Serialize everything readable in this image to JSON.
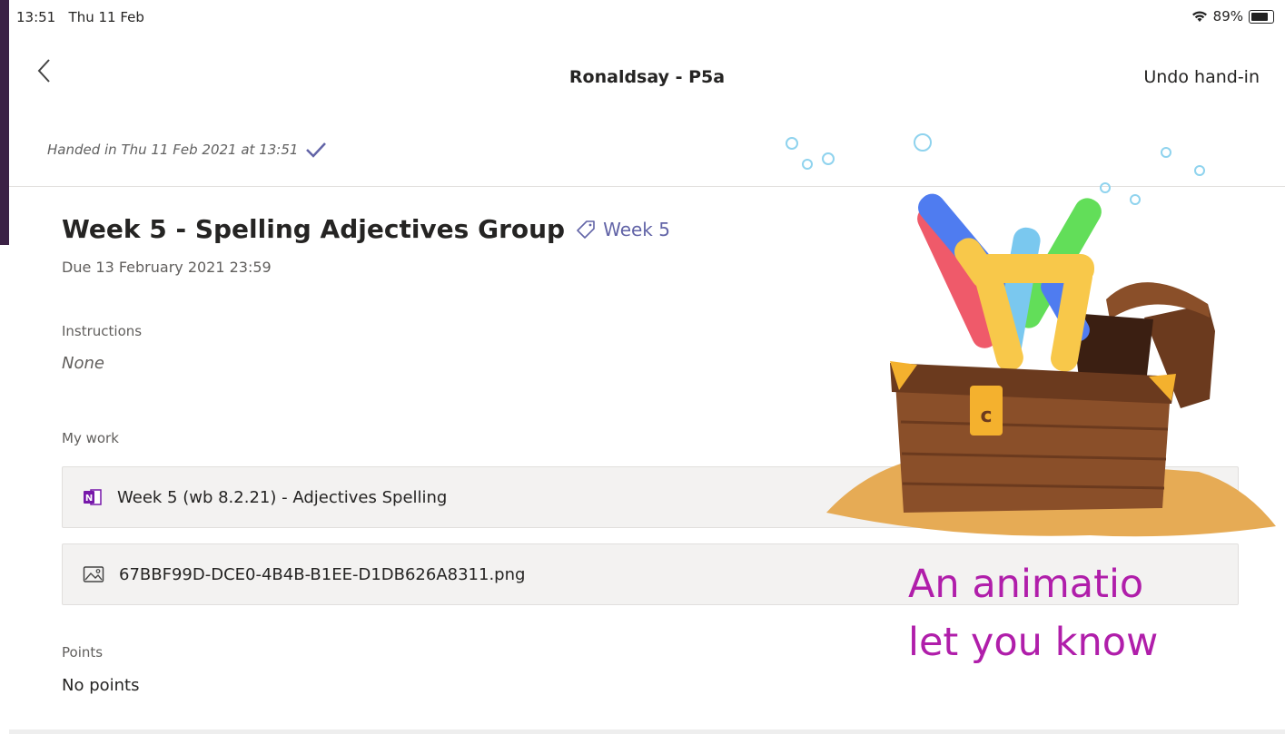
{
  "status_bar": {
    "time": "13:51",
    "date": "Thu 11 Feb",
    "battery": "89%",
    "battery_level": 0.89
  },
  "nav": {
    "title": "Ronaldsay - P5a",
    "undo_label": "Undo hand-in"
  },
  "handed_in": {
    "text": "Handed in Thu 11 Feb 2021 at 13:51"
  },
  "assignment": {
    "title": "Week 5 - Spelling Adjectives Group",
    "tag": "Week 5",
    "due": "Due 13 February 2021 23:59"
  },
  "instructions": {
    "label": "Instructions",
    "value": "None"
  },
  "my_work": {
    "label": "My work",
    "files": [
      {
        "name": "Week 5 (wb 8.2.21) - Adjectives Spelling",
        "icon": "onenote-icon"
      },
      {
        "name": "67BBF99D-DCE0-4B4B-B1EE-D1DB626A8311.png",
        "icon": "image-icon"
      }
    ]
  },
  "points": {
    "label": "Points",
    "value": "No points"
  },
  "overlay_text": "An animatio\nlet you know",
  "colors": {
    "accent": "#6264a7",
    "overlay_text": "#b01eaa",
    "frame": "#3b2145"
  }
}
